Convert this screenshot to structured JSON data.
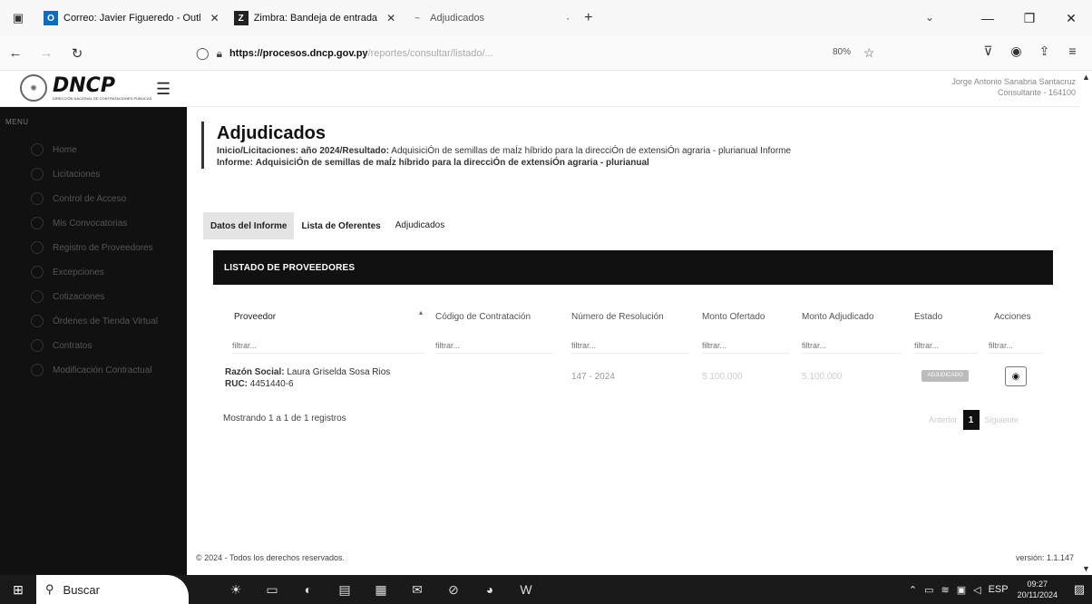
{
  "browser": {
    "tabs": [
      {
        "label": "Correo: Javier Figueredo - Outl",
        "icon": "outlook-icon",
        "color": "#0f6cbd"
      },
      {
        "label": "Zimbra: Bandeja de entrada",
        "icon": "zimbra-icon",
        "color": "#222222"
      },
      {
        "label": "Adjudicados",
        "icon": "page-icon",
        "color": "#888888"
      }
    ],
    "url_host": "https://procesos.dncp.gov.py",
    "url_path": "/reportes/consultar/listado/...",
    "zoom": "80%"
  },
  "app": {
    "logo": "DNCP",
    "logo_sub": "DIRECCIÓN NACIONAL DE CONTRATACIONES PÚBLICAS",
    "user_name": "Jorge Antonio Sanabria Santacruz",
    "user_id": "Consultante - 164100"
  },
  "sidebar": {
    "menu_label": "MENU",
    "items": [
      {
        "label": "Home"
      },
      {
        "label": "Licitaciones"
      },
      {
        "label": "Control de Acceso"
      },
      {
        "label": "Mis Convocatorias"
      },
      {
        "label": "Registro de Proveedores"
      },
      {
        "label": "Excepciones"
      },
      {
        "label": "Cotizaciones"
      },
      {
        "label": "Órdenes de Tienda Virtual"
      },
      {
        "label": "Contratos"
      },
      {
        "label": "Modificación Contractual"
      }
    ]
  },
  "page": {
    "title": "Adjudicados",
    "breadcrumb_prefix": "Inicio/Licitaciones: año 2024/Resultado:",
    "breadcrumb_rest": "AdquisiciÓn de semillas de maÍz híbrido para la direcciÓn de extensiÓn agraria - plurianual Informe",
    "informe_label": "Informe:",
    "informe_text": "AdquisiciÓn de semillas de maÍz híbrido para la direcciÓn de extensiÓn agraria - plurianual",
    "tabs": [
      "Datos del Informe",
      "Lista de Oferentes",
      "Adjudicados"
    ],
    "panel_title": "LISTADO DE PROVEEDORES",
    "columns": [
      "Proveedor",
      "Código de Contratación",
      "Número de Resolución",
      "Monto Ofertado",
      "Monto Adjudicado",
      "Estado",
      "Acciones"
    ],
    "filter_placeholder": "filtrar...",
    "row": {
      "razon_label": "Razón Social:",
      "razon_value": "Laura Griselda Sosa Rios",
      "ruc_label": "RUC:",
      "ruc_value": "4451440-6",
      "codigo": "",
      "resolucion": "147 - 2024",
      "monto_ofertado": "5.100.000",
      "monto_adjudicado": "5.100.000",
      "estado": "ADJUDICADO"
    },
    "showing": "Mostrando 1 a 1 de 1 registros",
    "pager_prev": "Anterior",
    "pager_page": "1",
    "pager_next": "Siguiente",
    "footer": "© 2024 - Todos los derechos reservados.",
    "version": "versión: 1.1.147"
  },
  "taskbar": {
    "search": "Buscar",
    "lang": "ESP",
    "time": "09:27",
    "date": "20/11/2024",
    "notifications": "2"
  }
}
